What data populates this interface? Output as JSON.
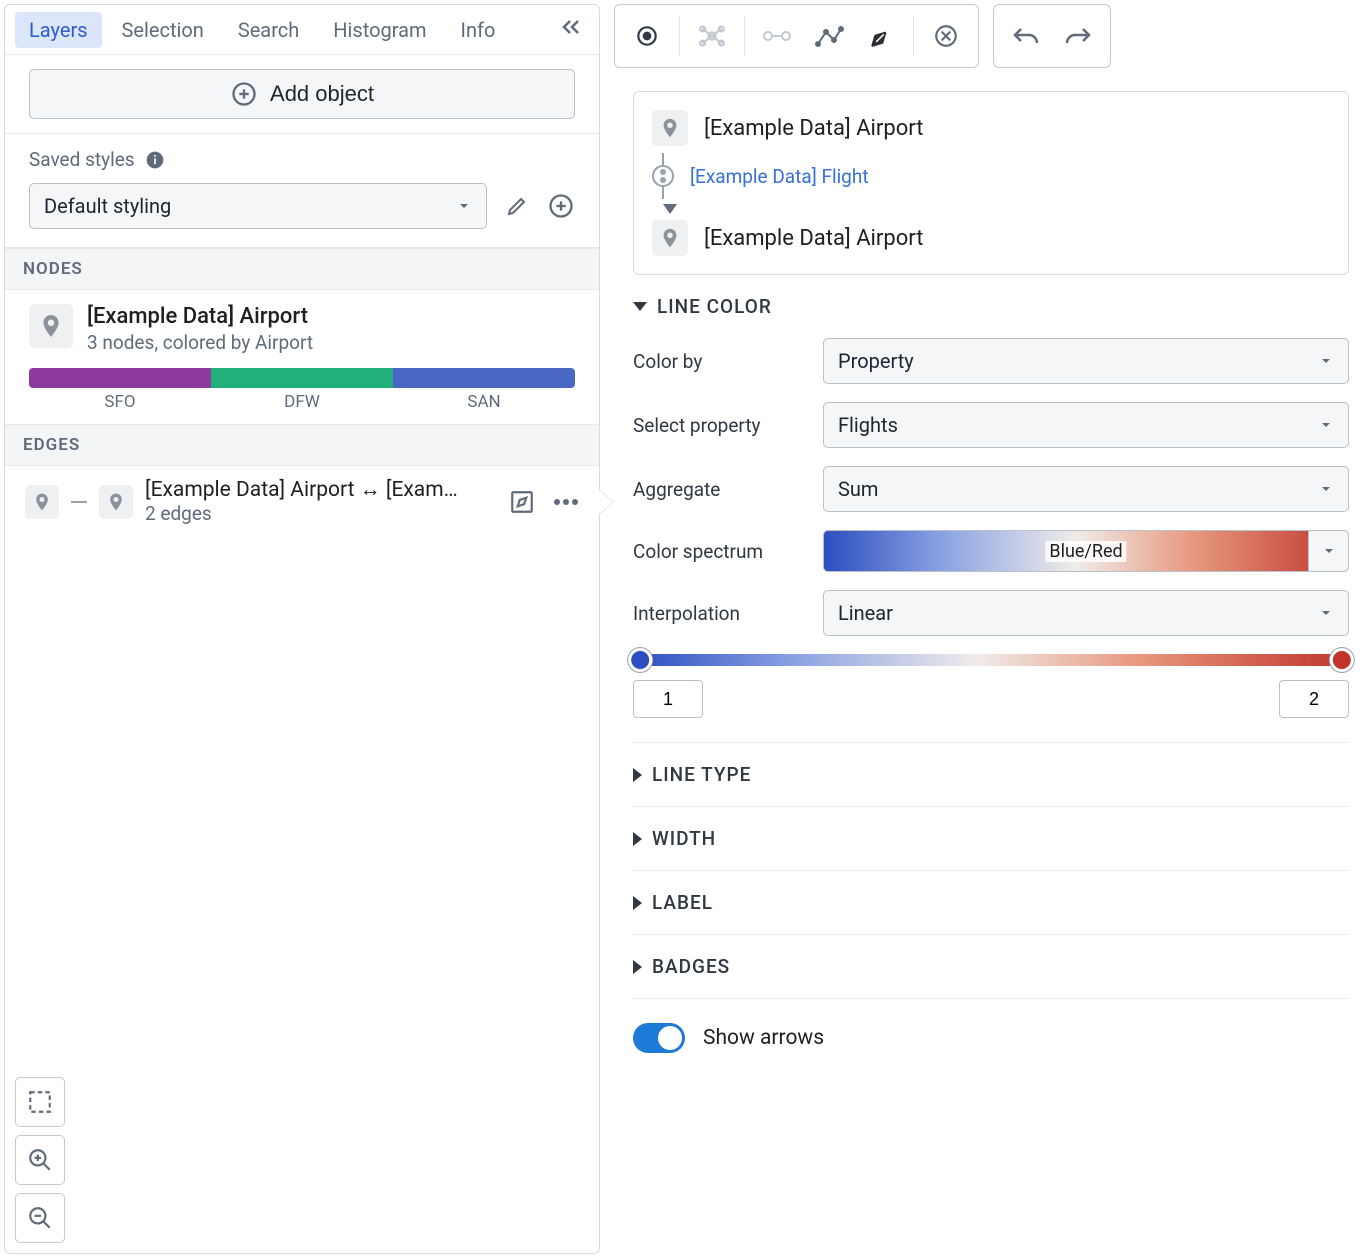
{
  "tabs": [
    "Layers",
    "Selection",
    "Search",
    "Histogram",
    "Info"
  ],
  "add_object": "Add object",
  "saved_styles_label": "Saved styles",
  "default_styling": "Default styling",
  "section_nodes": "NODES",
  "section_edges": "EDGES",
  "node": {
    "title": "[Example Data] Airport",
    "subtitle": "3 nodes, colored by Airport",
    "labels": [
      "SFO",
      "DFW",
      "SAN"
    ]
  },
  "edge": {
    "title": "[Example Data] Airport ↔ [Exam…",
    "subtitle": "2 edges"
  },
  "relation": {
    "from": "[Example Data] Airport",
    "via": "[Example Data] Flight",
    "to": "[Example Data] Airport"
  },
  "sections": {
    "line_color": "LINE COLOR",
    "line_type": "LINE TYPE",
    "width": "WIDTH",
    "label": "LABEL",
    "badges": "BADGES"
  },
  "line_color": {
    "lbl_color_by": "Color by",
    "val_color_by": "Property",
    "lbl_select_property": "Select property",
    "val_select_property": "Flights",
    "lbl_aggregate": "Aggregate",
    "val_aggregate": "Sum",
    "lbl_spectrum": "Color spectrum",
    "val_spectrum": "Blue/Red",
    "lbl_interpolation": "Interpolation",
    "val_interpolation": "Linear",
    "range_min": "1",
    "range_max": "2"
  },
  "show_arrows": "Show arrows"
}
